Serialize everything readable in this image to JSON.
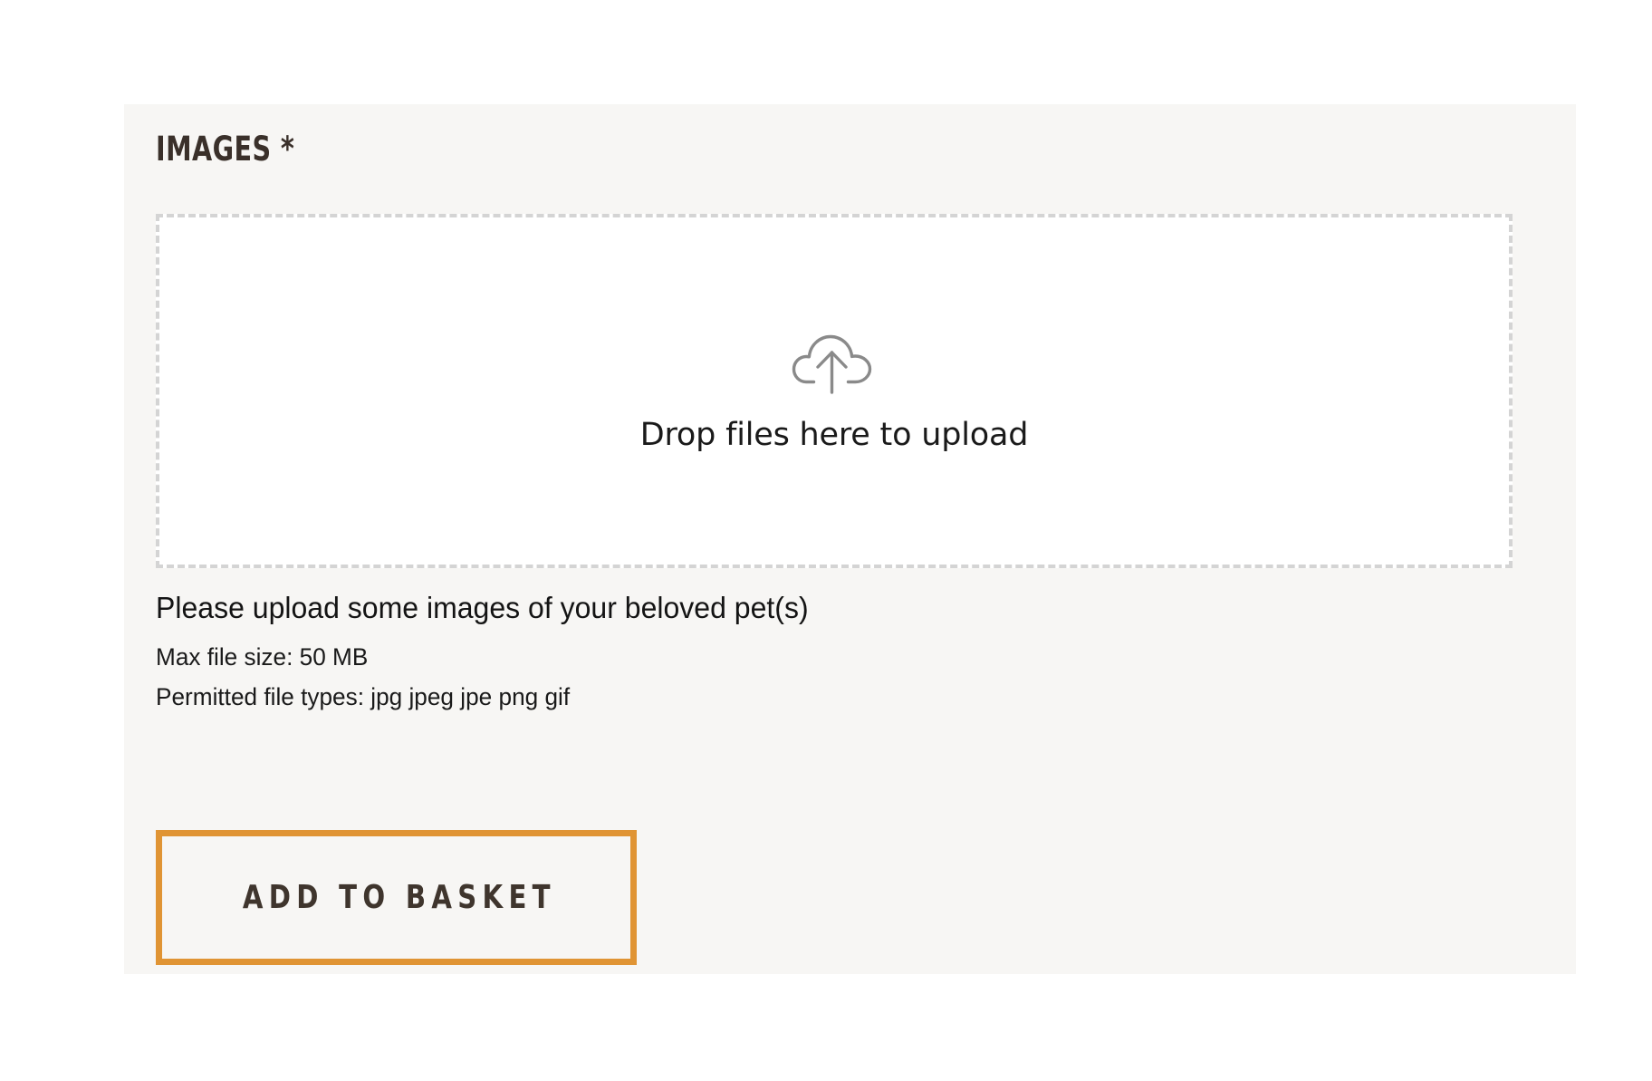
{
  "card": {
    "heading": "IMAGES *",
    "background_color": "#F7F6F4"
  },
  "dropzone": {
    "icon": "cloud-upload-icon",
    "label": "Drop files here to upload",
    "border_color": "#D4D4D4",
    "fill_color": "#FFFFFF",
    "icon_color": "#8A8A8A"
  },
  "help": {
    "primary": "Please upload some images of your beloved pet(s)",
    "max_file_size": "Max file size: 50 MB",
    "permitted_types": "Permitted file types: jpg jpeg jpe png gif"
  },
  "actions": {
    "add_to_basket_label": "ADD TO BASKET",
    "accent_color": "#E09434",
    "text_color": "#3F352D"
  }
}
